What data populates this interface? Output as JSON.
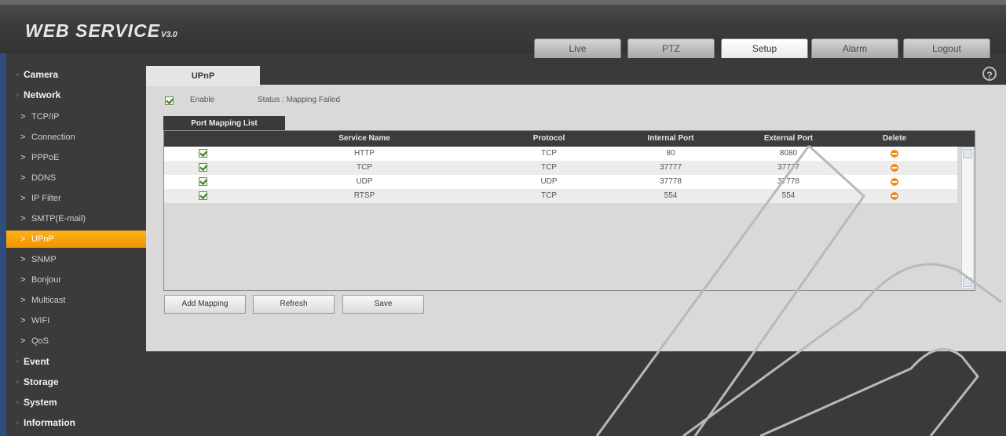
{
  "header": {
    "logo": "WEB SERVICE",
    "version": "V3.0",
    "tabs": [
      {
        "label": "Live",
        "active": false
      },
      {
        "label": "PTZ",
        "active": false
      },
      {
        "label": "Setup",
        "active": true
      },
      {
        "label": "Alarm",
        "active": false
      },
      {
        "label": "Logout",
        "active": false
      }
    ]
  },
  "sidebar": {
    "items": [
      {
        "label": "Camera",
        "level": "main"
      },
      {
        "label": "Network",
        "level": "main"
      },
      {
        "label": "TCP/IP",
        "level": "sub"
      },
      {
        "label": "Connection",
        "level": "sub"
      },
      {
        "label": "PPPoE",
        "level": "sub"
      },
      {
        "label": "DDNS",
        "level": "sub"
      },
      {
        "label": "IP Filter",
        "level": "sub"
      },
      {
        "label": "SMTP(E-mail)",
        "level": "sub"
      },
      {
        "label": "UPnP",
        "level": "sub",
        "active": true
      },
      {
        "label": "SNMP",
        "level": "sub"
      },
      {
        "label": "Bonjour",
        "level": "sub"
      },
      {
        "label": "Multicast",
        "level": "sub"
      },
      {
        "label": "WIFI",
        "level": "sub"
      },
      {
        "label": "QoS",
        "level": "sub"
      },
      {
        "label": "Event",
        "level": "main"
      },
      {
        "label": "Storage",
        "level": "main"
      },
      {
        "label": "System",
        "level": "main"
      },
      {
        "label": "Information",
        "level": "main"
      }
    ]
  },
  "page": {
    "tab_label": "UPnP",
    "help_icon": "?",
    "enable_label": "Enable",
    "enable_checked": true,
    "status_text": "Status : Mapping Failed",
    "list_tab": "Port Mapping List"
  },
  "table": {
    "columns": [
      "Service Name",
      "Protocol",
      "Internal Port",
      "External Port",
      "Delete"
    ],
    "rows": [
      {
        "checked": true,
        "service": "HTTP",
        "protocol": "TCP",
        "internal": "80",
        "external": "8080"
      },
      {
        "checked": true,
        "service": "TCP",
        "protocol": "TCP",
        "internal": "37777",
        "external": "37777"
      },
      {
        "checked": true,
        "service": "UDP",
        "protocol": "UDP",
        "internal": "37778",
        "external": "37778"
      },
      {
        "checked": true,
        "service": "RTSP",
        "protocol": "TCP",
        "internal": "554",
        "external": "554"
      }
    ]
  },
  "buttons": {
    "add_mapping": "Add Mapping",
    "refresh": "Refresh",
    "save": "Save"
  },
  "colors": {
    "accent": "#f39200",
    "header_bg": "#3c3c3c",
    "panel_bg": "#d9d9d9",
    "delete_icon": "#f28a1c"
  }
}
